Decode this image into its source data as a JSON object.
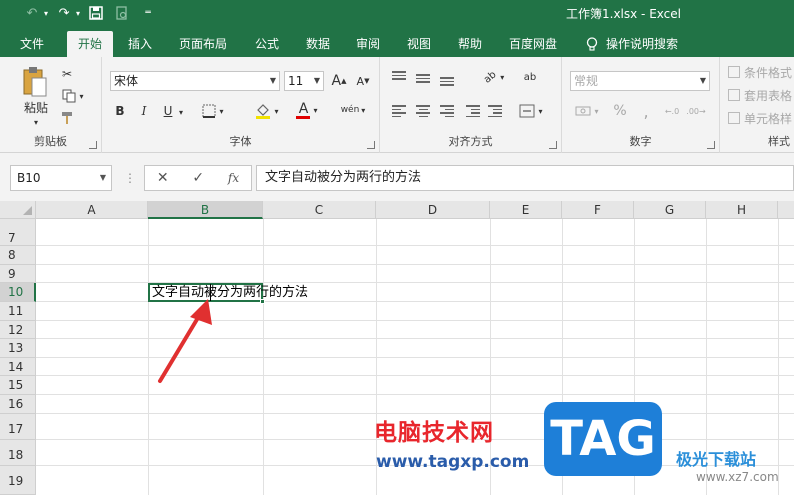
{
  "window": {
    "title": "工作簿1.xlsx  -  Excel"
  },
  "tabs": [
    "文件",
    "开始",
    "插入",
    "页面布局",
    "公式",
    "数据",
    "审阅",
    "视图",
    "帮助",
    "百度网盘"
  ],
  "active_tab": "开始",
  "tell_me": "操作说明搜索",
  "ribbon": {
    "clipboard": {
      "paste_label": "粘贴",
      "label": "剪贴板"
    },
    "font": {
      "font_name": "宋体",
      "font_size": "11",
      "grow": "A",
      "shrink": "A",
      "bold": "B",
      "italic": "I",
      "underline": "U",
      "font_color": "A",
      "phonetic": "wén",
      "label": "字体"
    },
    "alignment": {
      "label": "对齐方式"
    },
    "number": {
      "format": "常规",
      "percent": "%",
      "label": "数字"
    },
    "styles": {
      "conditional": "条件格式",
      "table": "套用表格",
      "cell": "单元格样",
      "label": "样式"
    }
  },
  "formula_bar": {
    "name_box": "B10",
    "cancel": "✕",
    "enter": "✓",
    "fx": "fx",
    "content": "文字自动被分为两行的方法"
  },
  "sheet": {
    "columns": [
      "A",
      "B",
      "C",
      "D",
      "E",
      "F",
      "G",
      "H"
    ],
    "rows": [
      "7",
      "8",
      "9",
      "10",
      "11",
      "12",
      "13",
      "14",
      "15",
      "16",
      "17",
      "18",
      "19"
    ],
    "selected_cell": "B10",
    "cell_text": "文字自动被分为两行的方法"
  },
  "watermark": {
    "cn": "电脑技术网",
    "url": "www.tagxp.com",
    "tag": "TAG",
    "site": "极光下载站",
    "site_url": "www.xz7.com"
  },
  "colors": {
    "excel_green": "#217346",
    "arrow_red": "#e03030",
    "tag_blue": "#1e7fd8"
  }
}
